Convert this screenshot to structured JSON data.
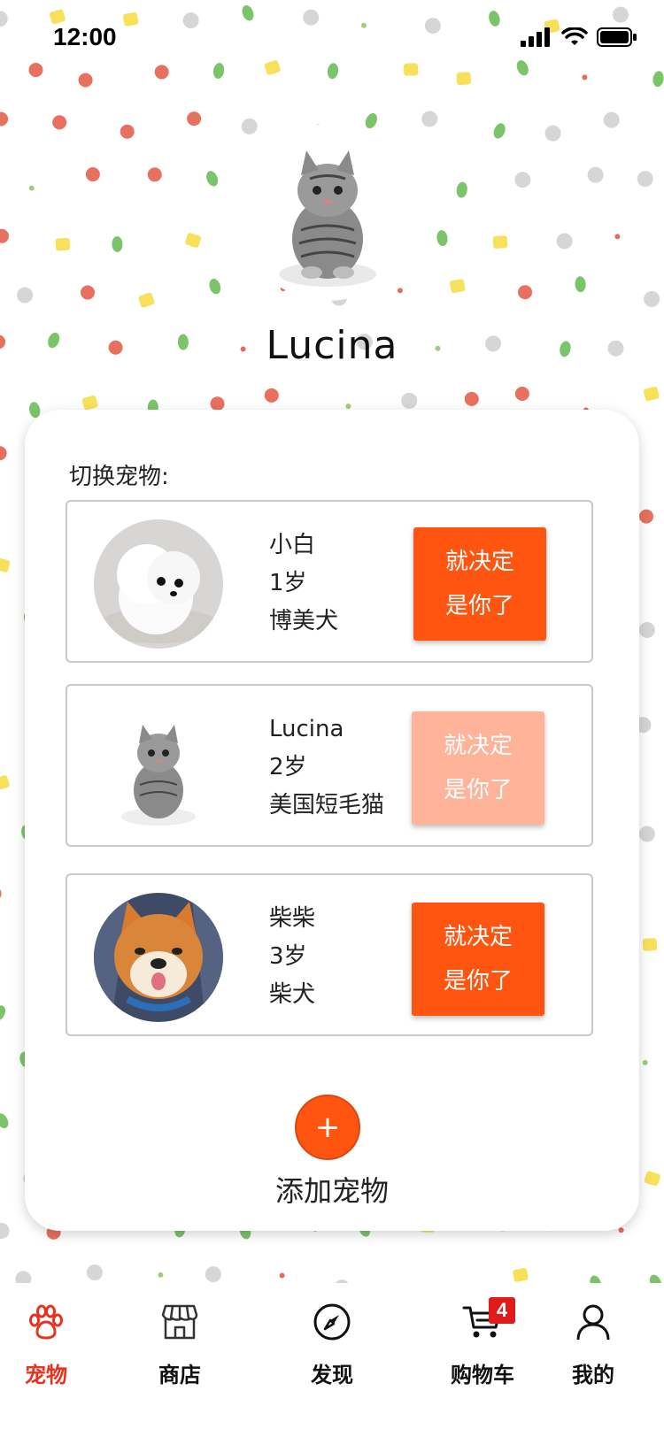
{
  "status_bar": {
    "time": "12:00"
  },
  "profile": {
    "name": "Lucina",
    "avatar": "cat-photo"
  },
  "switch_card": {
    "title": "切换宠物:",
    "pets": [
      {
        "name": "小白",
        "age": "1岁",
        "breed": "博美犬",
        "button_line1": "就决定",
        "button_line2": "是你了",
        "photo": "pomeranian-photo",
        "selected": false
      },
      {
        "name": "Lucina",
        "age": "2岁",
        "breed": "美国短毛猫",
        "button_line1": "就决定",
        "button_line2": "是你了",
        "photo": "cat-photo",
        "selected": true
      },
      {
        "name": "柴柴",
        "age": "3岁",
        "breed": "柴犬",
        "button_line1": "就决定",
        "button_line2": "是你了",
        "photo": "shiba-photo",
        "selected": false
      }
    ],
    "add_button": "+",
    "add_label": "添加宠物"
  },
  "tabbar": {
    "items": [
      {
        "label": "宠物",
        "icon": "paw-icon",
        "active": true
      },
      {
        "label": "商店",
        "icon": "store-icon",
        "active": false
      },
      {
        "label": "发现",
        "icon": "compass-icon",
        "active": false
      },
      {
        "label": "购物车",
        "icon": "cart-icon",
        "active": false,
        "badge": "4"
      },
      {
        "label": "我的",
        "icon": "user-icon",
        "active": false
      }
    ]
  },
  "colors": {
    "accent": "#ff5510",
    "accent_light": "#ffb399",
    "active_tab": "#e8321d",
    "badge": "#e01b1b"
  }
}
